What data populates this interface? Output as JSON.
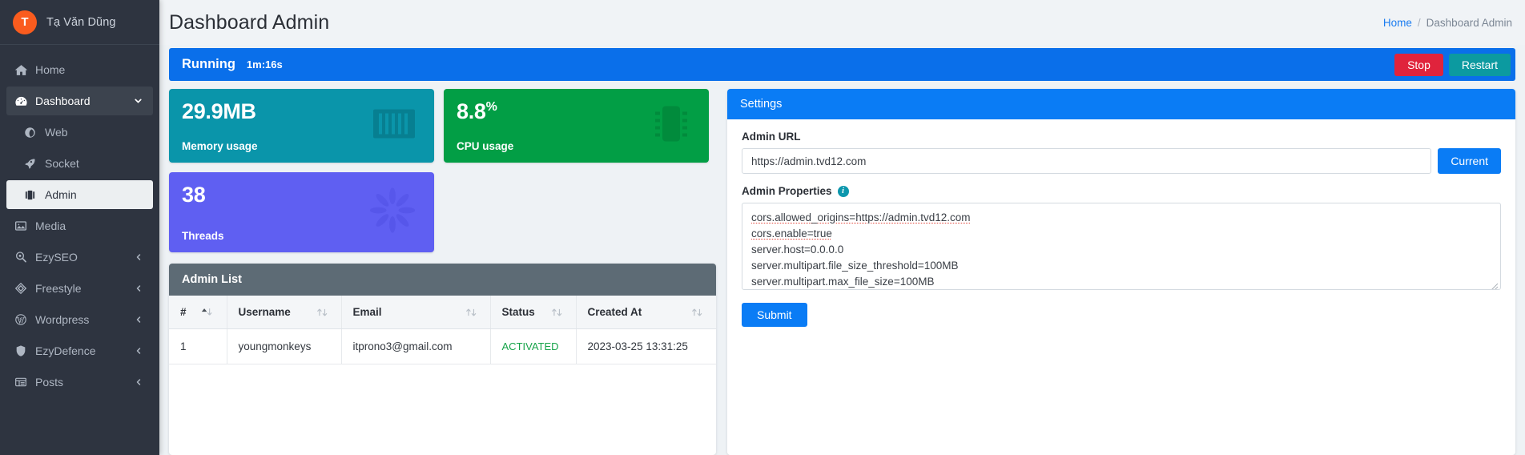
{
  "sidebar": {
    "user": {
      "initial": "T",
      "name": "Tạ Văn Dũng"
    },
    "items": [
      {
        "label": "Home",
        "icon": "home-icon",
        "state": "normal",
        "caret": "none"
      },
      {
        "label": "Dashboard",
        "icon": "dashboard-icon",
        "state": "active-dark",
        "caret": "down"
      },
      {
        "label": "Web",
        "icon": "globe-icon",
        "state": "sub",
        "caret": "none"
      },
      {
        "label": "Socket",
        "icon": "rocket-icon",
        "state": "sub",
        "caret": "none"
      },
      {
        "label": "Admin",
        "icon": "briefcase-icon",
        "state": "active-light",
        "caret": "none"
      },
      {
        "label": "Media",
        "icon": "image-icon",
        "state": "normal",
        "caret": "none"
      },
      {
        "label": "EzySEO",
        "icon": "search-pin-icon",
        "state": "normal",
        "caret": "right"
      },
      {
        "label": "Freestyle",
        "icon": "cube-icon",
        "state": "normal",
        "caret": "right"
      },
      {
        "label": "Wordpress",
        "icon": "wordpress-icon",
        "state": "normal",
        "caret": "right"
      },
      {
        "label": "EzyDefence",
        "icon": "shield-icon",
        "state": "normal",
        "caret": "right"
      },
      {
        "label": "Posts",
        "icon": "table-icon",
        "state": "normal",
        "caret": "right"
      }
    ]
  },
  "header": {
    "title": "Dashboard Admin",
    "breadcrumb": {
      "home": "Home",
      "separator": "/",
      "current": "Dashboard Admin"
    }
  },
  "statusbar": {
    "state": "Running",
    "uptime": "1m:16s",
    "stop_label": "Stop",
    "restart_label": "Restart",
    "bg_color": "#0a6fea",
    "stop_color": "#e0233c",
    "restart_color": "#0c9aa0"
  },
  "cards": [
    {
      "value": "29.9MB",
      "unit_sup": "",
      "label": "Memory usage",
      "icon": "memory-stick-icon",
      "color": "#0a95aa"
    },
    {
      "value": "8.8",
      "unit_sup": "%",
      "label": "CPU usage",
      "icon": "microchip-icon",
      "color": "#029e45"
    },
    {
      "value": "38",
      "unit_sup": "",
      "label": "Threads",
      "icon": "spinner-icon",
      "color": "#5f5ff2"
    }
  ],
  "admin_list": {
    "title": "Admin List",
    "columns": [
      {
        "label": "#",
        "sort": "asc"
      },
      {
        "label": "Username",
        "sort": "none"
      },
      {
        "label": "Email",
        "sort": "none"
      },
      {
        "label": "Status",
        "sort": "none"
      },
      {
        "label": "Created At",
        "sort": "none"
      }
    ],
    "rows": [
      {
        "index": "1",
        "username": "youngmonkeys",
        "email": "itprono3@gmail.com",
        "status": "ACTIVATED",
        "created_at": "2023-03-25 13:31:25"
      }
    ]
  },
  "settings": {
    "title": "Settings",
    "admin_url_label": "Admin URL",
    "admin_url_value": "https://admin.tvd12.com",
    "admin_url_placeholder": "https://admin.tvd12.com",
    "current_label": "Current",
    "properties_label": "Admin Properties",
    "properties_info_icon": "info-icon",
    "properties_lines": [
      "cors.allowed_origins=https://admin.tvd12.com",
      "cors.enable=true",
      "server.host=0.0.0.0",
      "server.multipart.file_size_threshold=100MB",
      "server.multipart.max_file_size=100MB"
    ],
    "submit_label": "Submit"
  }
}
